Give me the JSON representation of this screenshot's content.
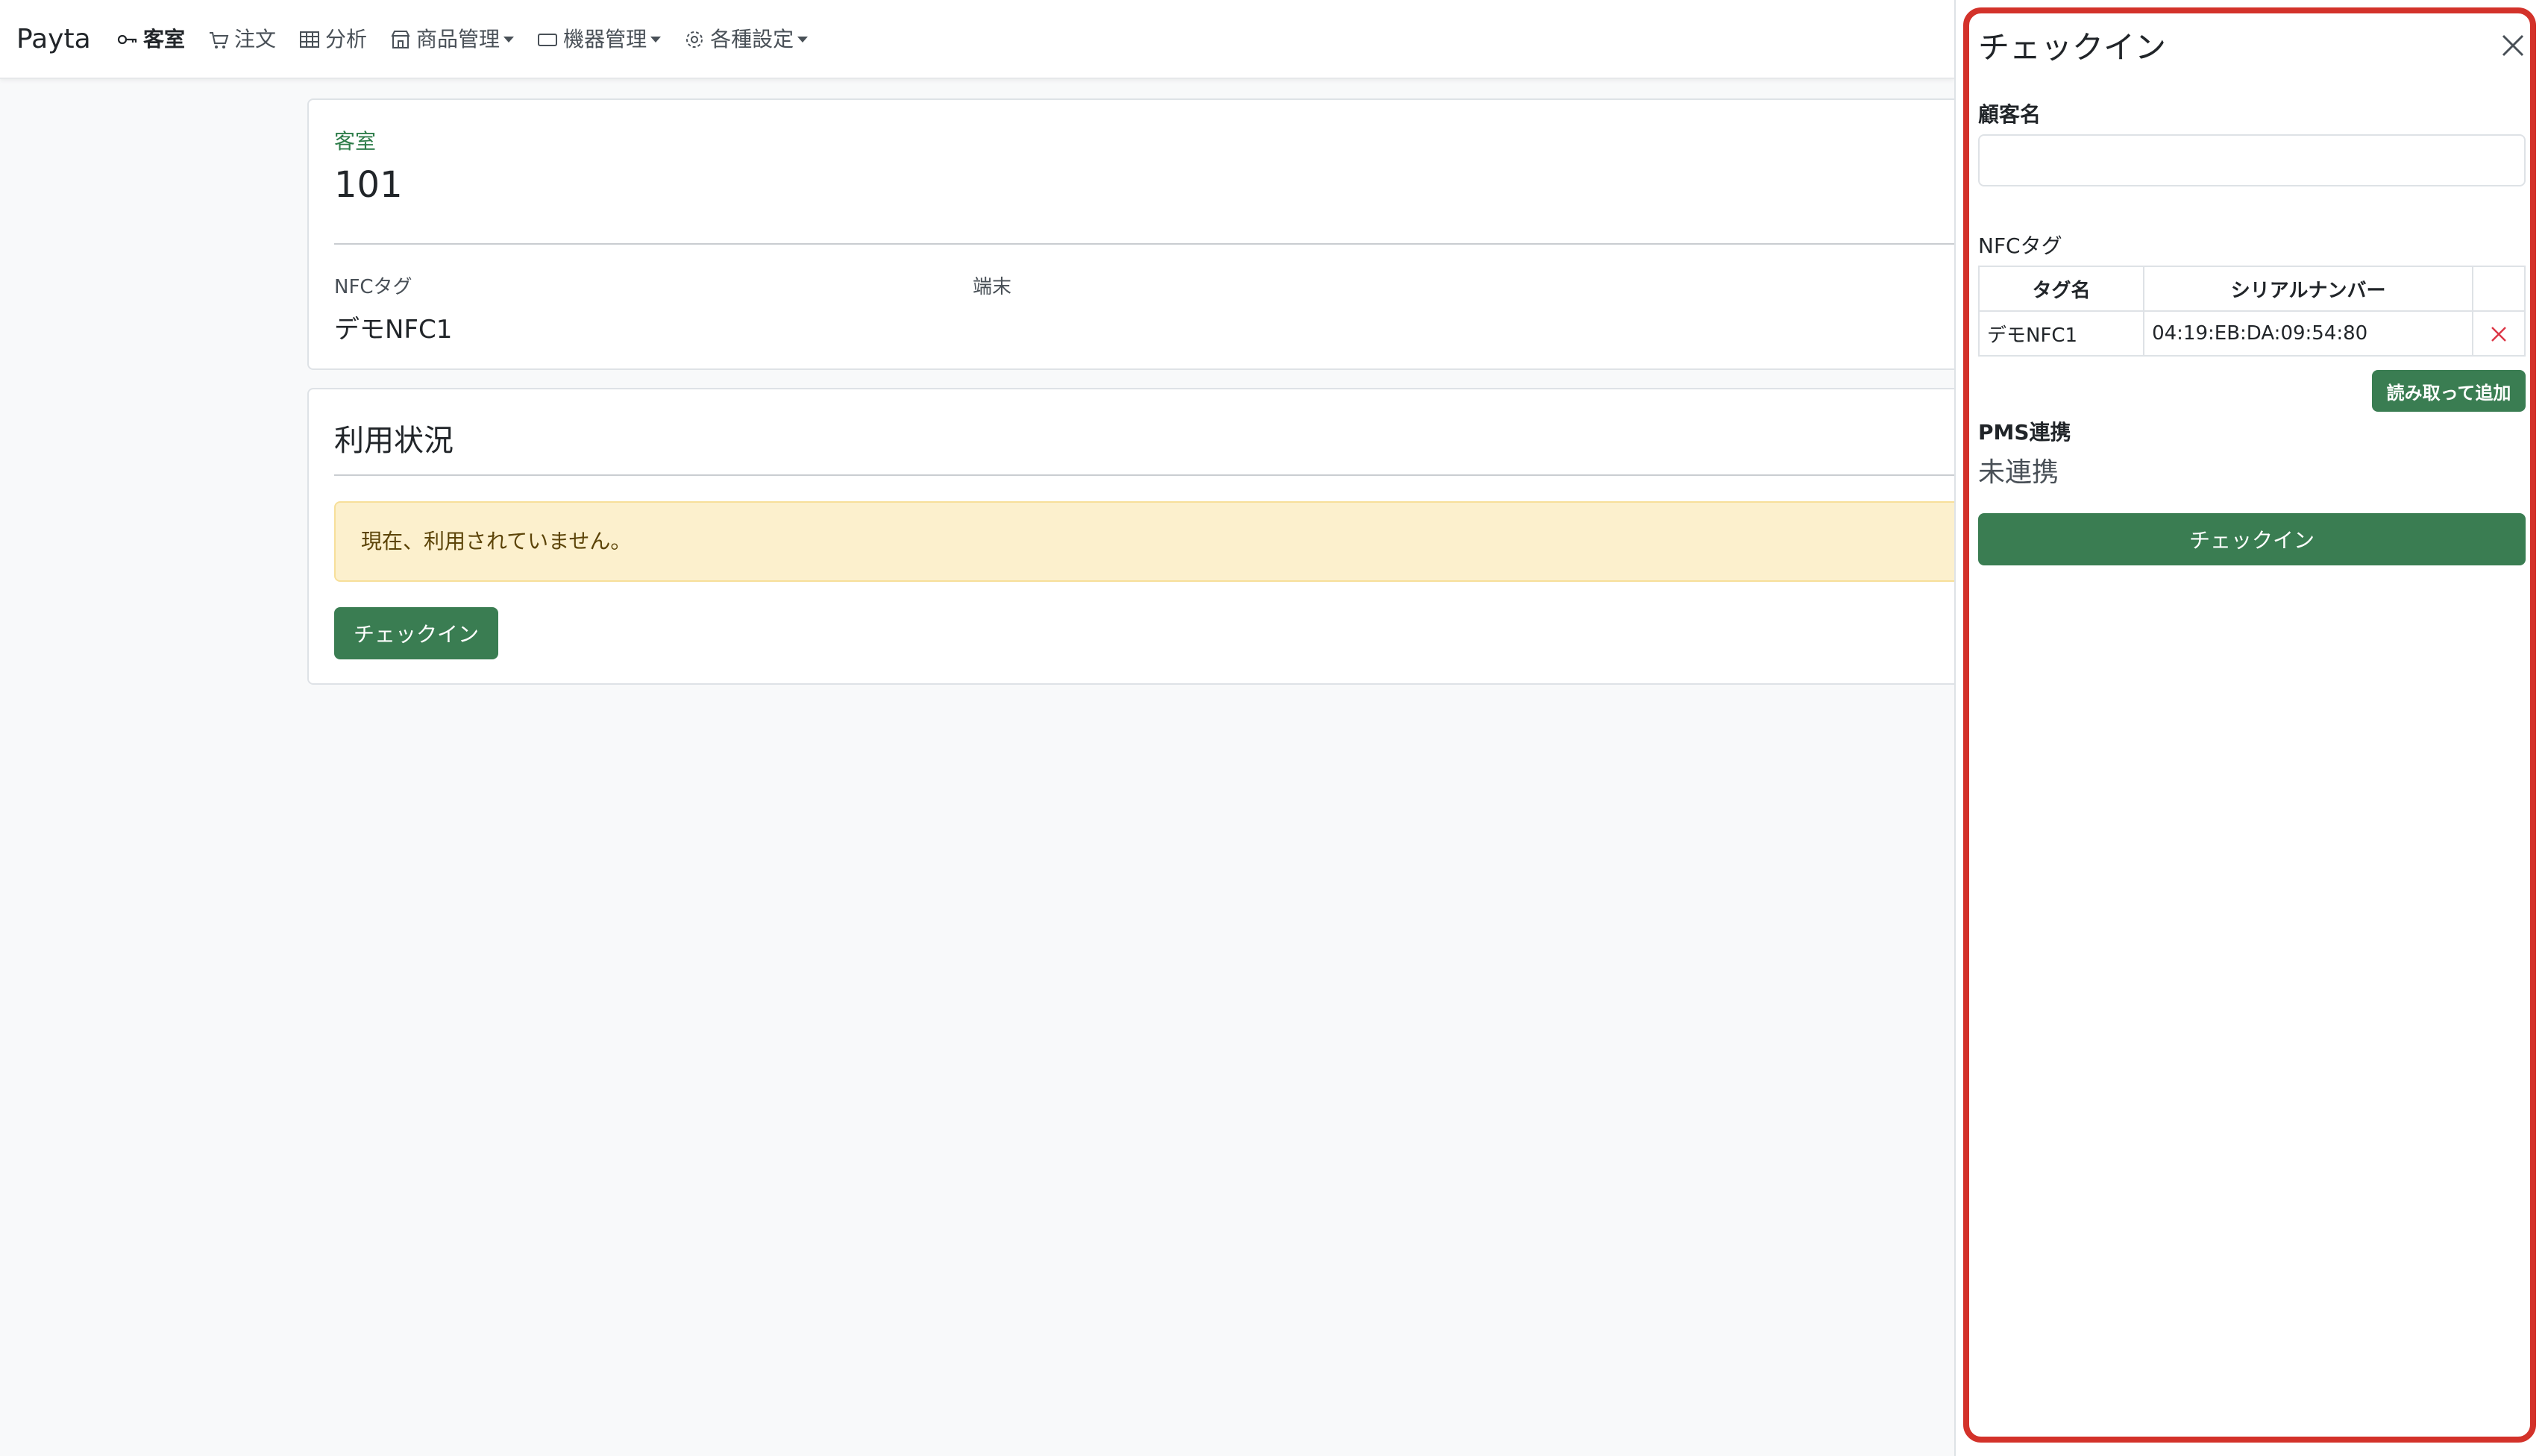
{
  "navbar": {
    "brand": "Payta",
    "items": [
      {
        "label": "客室",
        "icon": "key-icon",
        "active": true
      },
      {
        "label": "注文",
        "icon": "cart-icon"
      },
      {
        "label": "分析",
        "icon": "table-icon"
      },
      {
        "label": "商品管理",
        "icon": "shop-icon",
        "dropdown": true
      },
      {
        "label": "機器管理",
        "icon": "device-icon",
        "dropdown": true
      },
      {
        "label": "各種設定",
        "icon": "gear-icon",
        "dropdown": true
      }
    ]
  },
  "room_card": {
    "section_label": "客室",
    "room_number": "101",
    "nfc_label": "NFCタグ",
    "nfc_value": "デモNFC1",
    "terminal_label": "端末"
  },
  "usage_card": {
    "title": "利用状況",
    "alert": "現在、利用されていません。",
    "checkin_button": "チェックイン"
  },
  "offcanvas": {
    "title": "チェックイン",
    "customer_label": "顧客名",
    "customer_value": "",
    "nfc_section_label": "NFCタグ",
    "table": {
      "headers": [
        "タグ名",
        "シリアルナンバー",
        ""
      ],
      "rows": [
        {
          "tag_name": "デモNFC1",
          "serial": "04:19:EB:DA:09:54:80"
        }
      ]
    },
    "read_add_button": "読み取って追加",
    "pms_label": "PMS連携",
    "pms_status": "未連携",
    "checkin_button": "チェックイン"
  },
  "colors": {
    "accent_green": "#3a7d52",
    "label_green": "#2e7d4a",
    "alert_bg": "#fcf0cd",
    "highlight_red": "#d3322a",
    "delete_red": "#dc3545"
  }
}
